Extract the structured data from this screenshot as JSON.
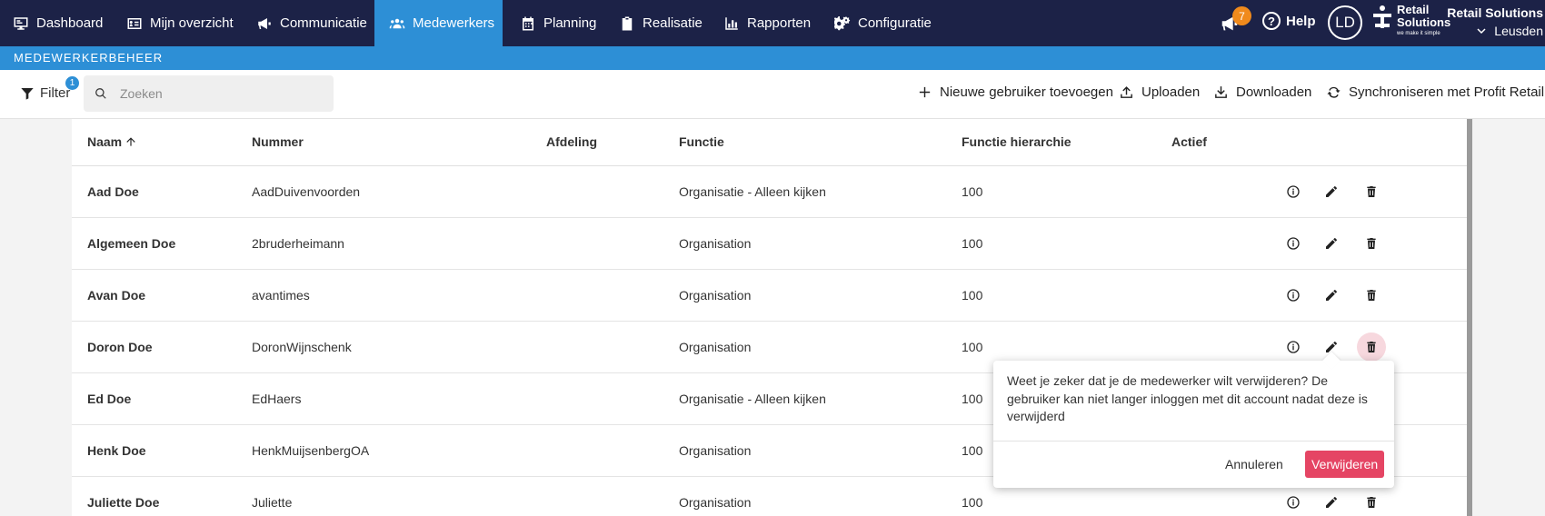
{
  "nav": {
    "items": [
      {
        "label": "Dashboard",
        "icon": "monitor-icon"
      },
      {
        "label": "Mijn overzicht",
        "icon": "id-card-icon"
      },
      {
        "label": "Communicatie",
        "icon": "megaphone-icon"
      },
      {
        "label": "Medewerkers",
        "icon": "users-icon",
        "active": true
      },
      {
        "label": "Planning",
        "icon": "calendar-icon"
      },
      {
        "label": "Realisatie",
        "icon": "clipboard-icon"
      },
      {
        "label": "Rapporten",
        "icon": "bar-chart-icon"
      },
      {
        "label": "Configuratie",
        "icon": "gears-icon"
      }
    ],
    "notification_count": "7",
    "help_label": "Help",
    "avatar_initials": "LD",
    "logo_text_1": "Retail",
    "logo_text_2": "Solutions",
    "logo_tagline": "we make it simple",
    "org_name": "Retail Solutions",
    "org_location": "Leusden"
  },
  "section_title": "MEDEWERKERBEHEER",
  "toolbar": {
    "filter_label": "Filter",
    "filter_count": "1",
    "search_placeholder": "Zoeken",
    "add_user_label": "Nieuwe gebruiker toevoegen",
    "upload_label": "Uploaden",
    "download_label": "Downloaden",
    "sync_label": "Synchroniseren met Profit Retail"
  },
  "table": {
    "columns": [
      "Naam",
      "Nummer",
      "Afdeling",
      "Functie",
      "Functie hierarchie",
      "Actief"
    ],
    "sort_column": "Naam",
    "sort_direction": "ascending",
    "rows": [
      {
        "name": "Aad Doe",
        "number": "AadDuivenvoorden",
        "department": "",
        "function": "Organisatie - Alleen kijken",
        "hierarchy": "100"
      },
      {
        "name": "Algemeen Doe",
        "number": "2bruderheimann",
        "department": "",
        "function": "Organisation",
        "hierarchy": "100"
      },
      {
        "name": "Avan Doe",
        "number": "avantimes",
        "department": "",
        "function": "Organisation",
        "hierarchy": "100"
      },
      {
        "name": "Doron Doe",
        "number": "DoronWijnschenk",
        "department": "",
        "function": "Organisation",
        "hierarchy": "100"
      },
      {
        "name": "Ed Doe",
        "number": "EdHaers",
        "department": "",
        "function": "Organisatie - Alleen kijken",
        "hierarchy": "100"
      },
      {
        "name": "Henk Doe",
        "number": "HenkMuijsenbergOA",
        "department": "",
        "function": "Organisation",
        "hierarchy": "100"
      },
      {
        "name": "Juliette Doe",
        "number": "Juliette",
        "department": "",
        "function": "Organisation",
        "hierarchy": "100"
      }
    ]
  },
  "confirm_dialog": {
    "message": "Weet je zeker dat je de medewerker wilt verwijderen? De gebruiker kan niet langer inloggen met dit account nadat deze is verwijderd",
    "cancel_label": "Annuleren",
    "confirm_label": "Verwijderen"
  },
  "colors": {
    "nav_bg": "#1c2247",
    "accent": "#2d8fd6",
    "badge": "#f08a1c",
    "danger": "#e54564",
    "delete_highlight": "#f7d8de"
  }
}
